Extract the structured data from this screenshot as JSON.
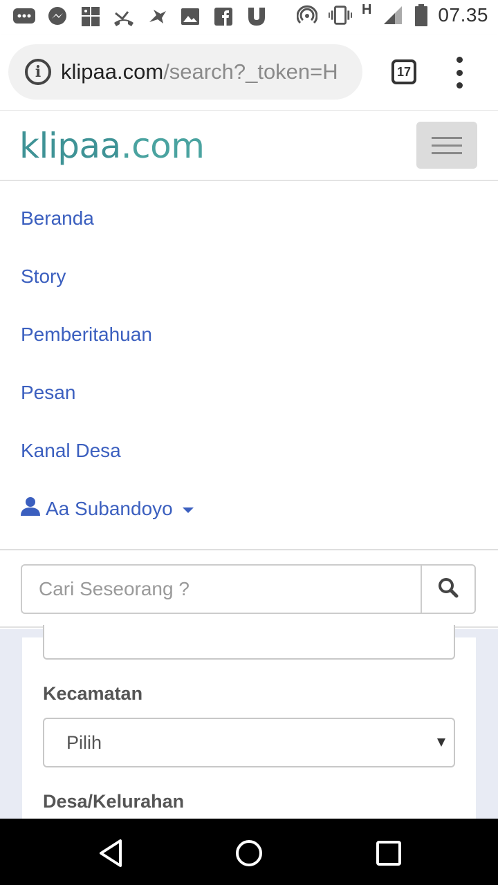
{
  "status_bar": {
    "time": "07.35",
    "network_label": "H",
    "icons": [
      "chat-icon",
      "messenger-icon",
      "photo-gallery-icon",
      "missed-call-icon",
      "bird-icon",
      "image-icon",
      "facebook-icon",
      "shield-u-icon",
      "hotspot-icon",
      "vibrate-icon",
      "signal-icon",
      "battery-icon"
    ]
  },
  "browser": {
    "url_host": "klipaa.com",
    "url_path": "/search?_token=H",
    "tab_count": "17"
  },
  "site": {
    "logo_main": "klipaa",
    "logo_suffix": ".com"
  },
  "menu": {
    "items": [
      {
        "label": "Beranda"
      },
      {
        "label": "Story"
      },
      {
        "label": "Pemberitahuan"
      },
      {
        "label": "Pesan"
      },
      {
        "label": "Kanal Desa"
      }
    ],
    "user_name": "Aa Subandoyo"
  },
  "search": {
    "placeholder": "Cari Seseorang ?"
  },
  "form": {
    "kecamatan_label": "Kecamatan",
    "kecamatan_value": "Pilih",
    "desa_label": "Desa/Kelurahan"
  },
  "colors": {
    "link": "#3b5fbf",
    "logo": "#3f9396",
    "form_bg": "#e8ebf4"
  }
}
